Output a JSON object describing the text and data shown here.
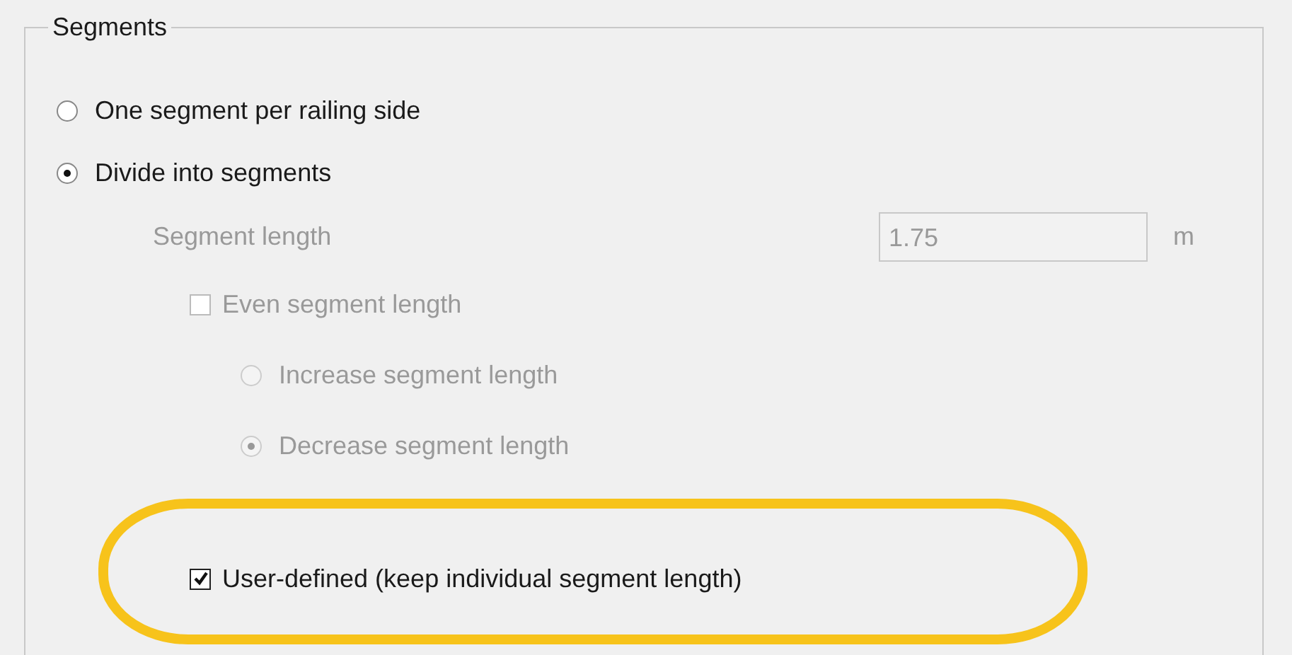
{
  "group": {
    "title": "Segments"
  },
  "mode_options": [
    {
      "label": "One segment per railing side",
      "selected": false
    },
    {
      "label": "Divide into segments",
      "selected": true
    }
  ],
  "segment_length": {
    "label": "Segment length",
    "value": "1.75",
    "unit": "m",
    "disabled": true
  },
  "even_length": {
    "label": "Even segment length",
    "checked": false,
    "disabled": true
  },
  "adjust_options": [
    {
      "label": "Increase segment length",
      "selected": false,
      "disabled": true
    },
    {
      "label": "Decrease segment length",
      "selected": true,
      "disabled": true
    }
  ],
  "user_defined": {
    "label": "User-defined (keep individual segment length)",
    "checked": true,
    "disabled": false
  }
}
